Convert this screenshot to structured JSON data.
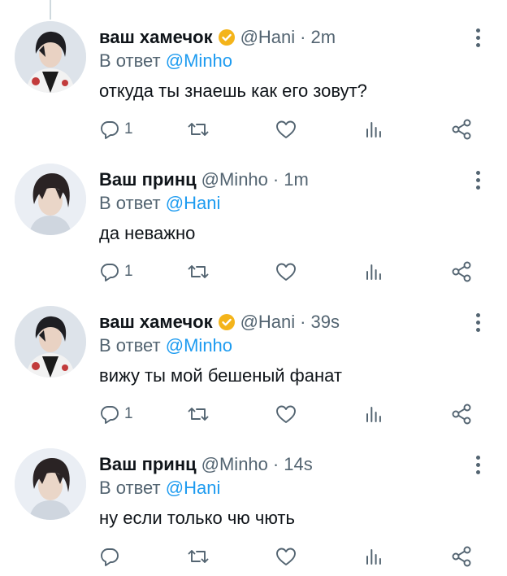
{
  "colors": {
    "text": "#0f1419",
    "muted": "#536471",
    "link": "#1d9bf0",
    "badge": "#f4b41a"
  },
  "tweets": [
    {
      "author": "ваш хамечок",
      "verified": true,
      "handle": "@Hani",
      "separator": "·",
      "time": "2m",
      "reply_prefix": "В ответ",
      "reply_to": "@Minho",
      "text": "откуда ты знаешь как его зовут?",
      "reply_count": "1",
      "avatar": "avatar-hani"
    },
    {
      "author": "Ваш принц",
      "verified": false,
      "handle": "@Minho",
      "separator": "·",
      "time": "1m",
      "reply_prefix": "В ответ",
      "reply_to": "@Hani",
      "text": "да неважно",
      "reply_count": "1",
      "avatar": "avatar-minho"
    },
    {
      "author": "ваш хамечок",
      "verified": true,
      "handle": "@Hani",
      "separator": "·",
      "time": "39s",
      "reply_prefix": "В ответ",
      "reply_to": "@Minho",
      "text": "вижу ты мой бешеный фанат",
      "reply_count": "1",
      "avatar": "avatar-hani"
    },
    {
      "author": "Ваш принц",
      "verified": false,
      "handle": "@Minho",
      "separator": "·",
      "time": "14s",
      "reply_prefix": "В ответ",
      "reply_to": "@Hani",
      "text": "ну если только чю чють",
      "reply_count": "",
      "avatar": "avatar-minho"
    }
  ],
  "icons": [
    "reply-icon",
    "retweet-icon",
    "like-icon",
    "views-icon",
    "share-icon",
    "more-icon",
    "verified-badge-icon"
  ]
}
